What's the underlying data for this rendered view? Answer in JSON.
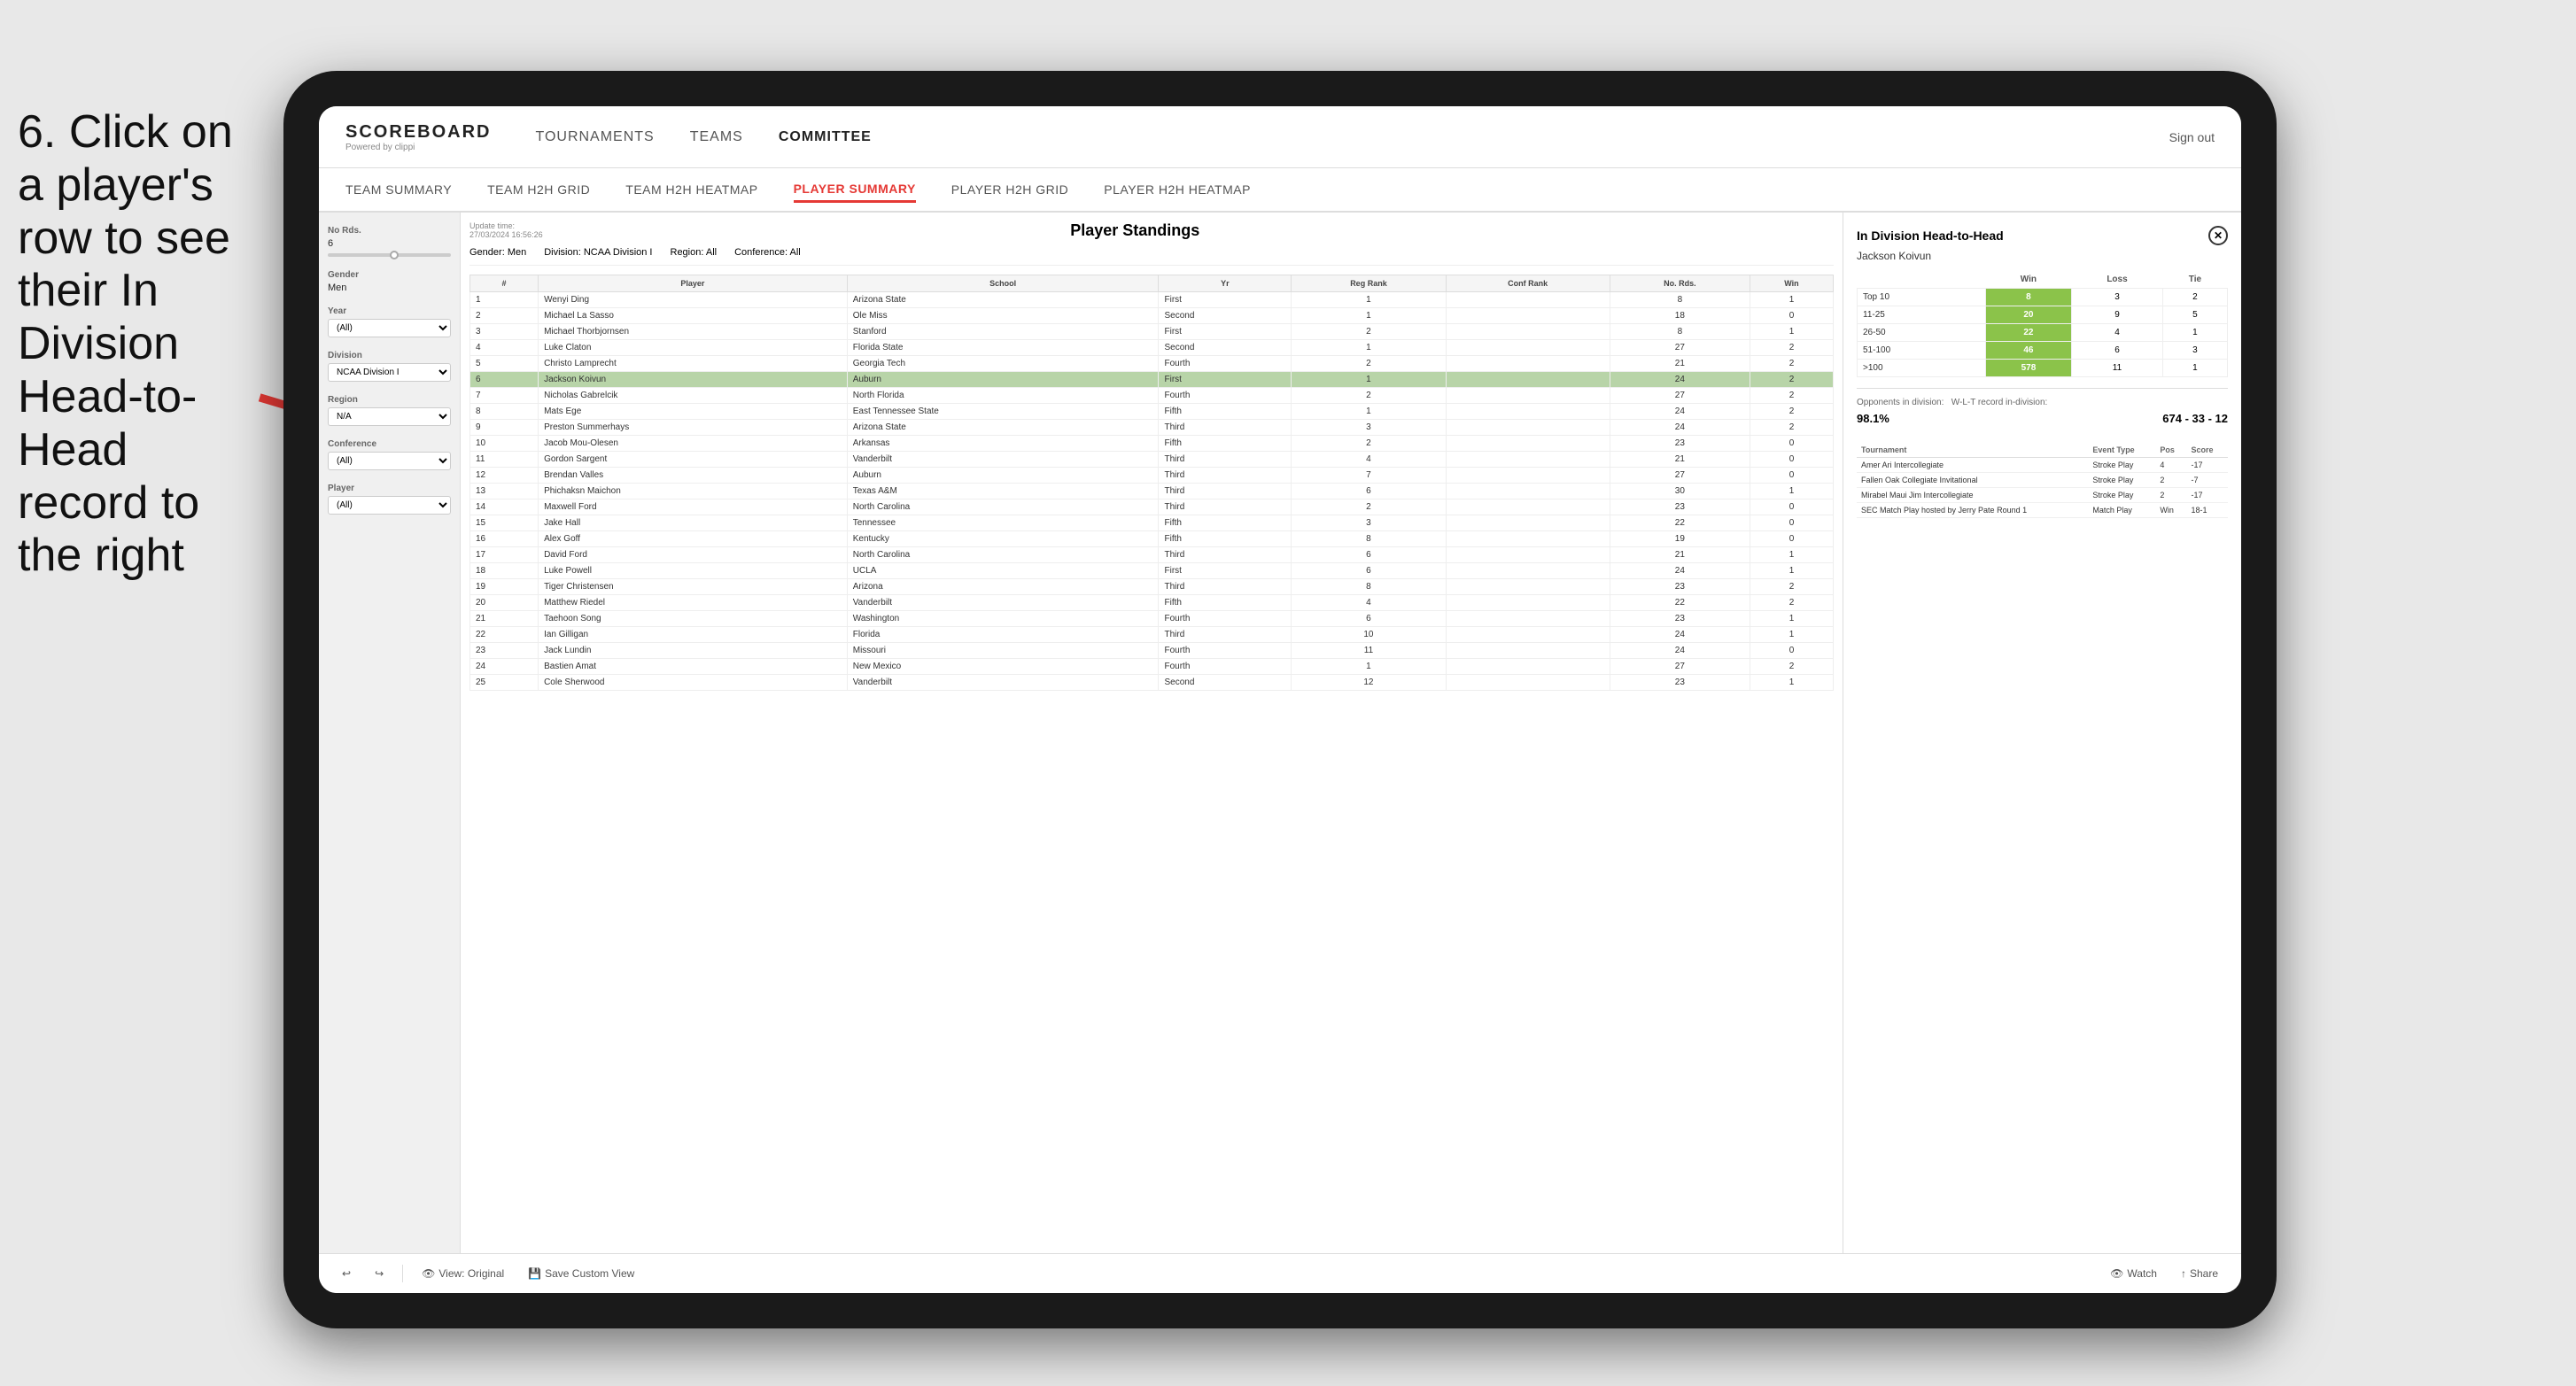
{
  "instruction": {
    "text": "6. Click on a player's row to see their In Division Head-to-Head record to the right"
  },
  "tablet": {
    "top_nav": {
      "logo": "SCOREBOARD",
      "logo_sub": "Powered by clippi",
      "nav_items": [
        "TOURNAMENTS",
        "TEAMS",
        "COMMITTEE"
      ],
      "sign_out": "Sign out"
    },
    "sub_nav": {
      "items": [
        "TEAM SUMMARY",
        "TEAM H2H GRID",
        "TEAM H2H HEATMAP",
        "PLAYER SUMMARY",
        "PLAYER H2H GRID",
        "PLAYER H2H HEATMAP"
      ],
      "active": "PLAYER SUMMARY"
    },
    "sidebar": {
      "no_rds_label": "No Rds.",
      "no_rds_value": "6",
      "gender_label": "Gender",
      "gender_value": "Men",
      "year_label": "Year",
      "year_value": "(All)",
      "division_label": "Division",
      "division_value": "NCAA Division I",
      "region_label": "Region",
      "region_value": "N/A",
      "conference_label": "Conference",
      "conference_value": "(All)",
      "player_label": "Player",
      "player_value": "(All)"
    },
    "standings": {
      "title": "Player Standings",
      "update_time": "Update time:",
      "update_date": "27/03/2024 16:56:26",
      "gender_label": "Gender:",
      "gender_value": "Men",
      "division_label": "Division:",
      "division_value": "NCAA Division I",
      "region_label": "Region:",
      "region_value": "All",
      "conference_label": "Conference:",
      "conference_value": "All",
      "columns": [
        "#",
        "Player",
        "School",
        "Yr",
        "Reg Rank",
        "Conf Rank",
        "No. Rds.",
        "Win"
      ],
      "rows": [
        {
          "num": 1,
          "player": "Wenyi Ding",
          "school": "Arizona State",
          "yr": "First",
          "reg": 1,
          "conf": "",
          "rds": 8,
          "win": 1,
          "highlighted": false
        },
        {
          "num": 2,
          "player": "Michael La Sasso",
          "school": "Ole Miss",
          "yr": "Second",
          "reg": 1,
          "conf": "",
          "rds": 18,
          "win": 0,
          "highlighted": false
        },
        {
          "num": 3,
          "player": "Michael Thorbjornsen",
          "school": "Stanford",
          "yr": "First",
          "reg": 2,
          "conf": "",
          "rds": 8,
          "win": 1,
          "highlighted": false
        },
        {
          "num": 4,
          "player": "Luke Claton",
          "school": "Florida State",
          "yr": "Second",
          "reg": 1,
          "conf": "",
          "rds": 27,
          "win": 2,
          "highlighted": false
        },
        {
          "num": 5,
          "player": "Christo Lamprecht",
          "school": "Georgia Tech",
          "yr": "Fourth",
          "reg": 2,
          "conf": "",
          "rds": 21,
          "win": 2,
          "highlighted": false
        },
        {
          "num": 6,
          "player": "Jackson Koivun",
          "school": "Auburn",
          "yr": "First",
          "reg": 1,
          "conf": "",
          "rds": 24,
          "win": 2,
          "highlighted": true
        },
        {
          "num": 7,
          "player": "Nicholas Gabrelcik",
          "school": "North Florida",
          "yr": "Fourth",
          "reg": 2,
          "conf": "",
          "rds": 27,
          "win": 2,
          "highlighted": false
        },
        {
          "num": 8,
          "player": "Mats Ege",
          "school": "East Tennessee State",
          "yr": "Fifth",
          "reg": 1,
          "conf": "",
          "rds": 24,
          "win": 2,
          "highlighted": false
        },
        {
          "num": 9,
          "player": "Preston Summerhays",
          "school": "Arizona State",
          "yr": "Third",
          "reg": 3,
          "conf": "",
          "rds": 24,
          "win": 2,
          "highlighted": false
        },
        {
          "num": 10,
          "player": "Jacob Mou-Olesen",
          "school": "Arkansas",
          "yr": "Fifth",
          "reg": 2,
          "conf": "",
          "rds": 23,
          "win": 0,
          "highlighted": false
        },
        {
          "num": 11,
          "player": "Gordon Sargent",
          "school": "Vanderbilt",
          "yr": "Third",
          "reg": 4,
          "conf": "",
          "rds": 21,
          "win": 0,
          "highlighted": false
        },
        {
          "num": 12,
          "player": "Brendan Valles",
          "school": "Auburn",
          "yr": "Third",
          "reg": 7,
          "conf": "",
          "rds": 27,
          "win": 0,
          "highlighted": false
        },
        {
          "num": 13,
          "player": "Phichaksn Maichon",
          "school": "Texas A&M",
          "yr": "Third",
          "reg": 6,
          "conf": "",
          "rds": 30,
          "win": 1,
          "highlighted": false
        },
        {
          "num": 14,
          "player": "Maxwell Ford",
          "school": "North Carolina",
          "yr": "Third",
          "reg": 2,
          "conf": "",
          "rds": 23,
          "win": 0,
          "highlighted": false
        },
        {
          "num": 15,
          "player": "Jake Hall",
          "school": "Tennessee",
          "yr": "Fifth",
          "reg": 3,
          "conf": "",
          "rds": 22,
          "win": 0,
          "highlighted": false
        },
        {
          "num": 16,
          "player": "Alex Goff",
          "school": "Kentucky",
          "yr": "Fifth",
          "reg": 8,
          "conf": "",
          "rds": 19,
          "win": 0,
          "highlighted": false
        },
        {
          "num": 17,
          "player": "David Ford",
          "school": "North Carolina",
          "yr": "Third",
          "reg": 6,
          "conf": "",
          "rds": 21,
          "win": 1,
          "highlighted": false
        },
        {
          "num": 18,
          "player": "Luke Powell",
          "school": "UCLA",
          "yr": "First",
          "reg": 6,
          "conf": "",
          "rds": 24,
          "win": 1,
          "highlighted": false
        },
        {
          "num": 19,
          "player": "Tiger Christensen",
          "school": "Arizona",
          "yr": "Third",
          "reg": 8,
          "conf": "",
          "rds": 23,
          "win": 2,
          "highlighted": false
        },
        {
          "num": 20,
          "player": "Matthew Riedel",
          "school": "Vanderbilt",
          "yr": "Fifth",
          "reg": 4,
          "conf": "",
          "rds": 22,
          "win": 2,
          "highlighted": false
        },
        {
          "num": 21,
          "player": "Taehoon Song",
          "school": "Washington",
          "yr": "Fourth",
          "reg": 6,
          "conf": "",
          "rds": 23,
          "win": 1,
          "highlighted": false
        },
        {
          "num": 22,
          "player": "Ian Gilligan",
          "school": "Florida",
          "yr": "Third",
          "reg": 10,
          "conf": "",
          "rds": 24,
          "win": 1,
          "highlighted": false
        },
        {
          "num": 23,
          "player": "Jack Lundin",
          "school": "Missouri",
          "yr": "Fourth",
          "reg": 11,
          "conf": "",
          "rds": 24,
          "win": 0,
          "highlighted": false
        },
        {
          "num": 24,
          "player": "Bastien Amat",
          "school": "New Mexico",
          "yr": "Fourth",
          "reg": 1,
          "conf": "",
          "rds": 27,
          "win": 2,
          "highlighted": false
        },
        {
          "num": 25,
          "player": "Cole Sherwood",
          "school": "Vanderbilt",
          "yr": "Second",
          "reg": 12,
          "conf": "",
          "rds": 23,
          "win": 1,
          "highlighted": false
        }
      ]
    },
    "h2h": {
      "title": "In Division Head-to-Head",
      "player_name": "Jackson Koivun",
      "table_headers": [
        "Win",
        "Loss",
        "Tie"
      ],
      "rank_rows": [
        {
          "label": "Top 10",
          "win": 8,
          "loss": 3,
          "tie": 2
        },
        {
          "label": "11-25",
          "win": 20,
          "loss": 9,
          "tie": 5
        },
        {
          "label": "26-50",
          "win": 22,
          "loss": 4,
          "tie": 1
        },
        {
          "label": "51-100",
          "win": 46,
          "loss": 6,
          "tie": 3
        },
        {
          "label": ">100",
          "win": 578,
          "loss": 11,
          "tie": 1
        }
      ],
      "opponents_label": "Opponents in division:",
      "wlt_label": "W-L-T record in-division:",
      "pct": "98.1%",
      "wlt": "674 - 33 - 12",
      "tournaments_headers": [
        "Tournament",
        "Event Type",
        "Pos",
        "Score"
      ],
      "tournaments": [
        {
          "tournament": "Amer Ari Intercollegiate",
          "type": "Stroke Play",
          "pos": 4,
          "score": "-17"
        },
        {
          "tournament": "Fallen Oak Collegiate Invitational",
          "type": "Stroke Play",
          "pos": 2,
          "score": "-7"
        },
        {
          "tournament": "Mirabel Maui Jim Intercollegiate",
          "type": "Stroke Play",
          "pos": 2,
          "score": "-17"
        },
        {
          "tournament": "SEC Match Play hosted by Jerry Pate Round 1",
          "type": "Match Play",
          "pos": "Win",
          "score": "18-1"
        }
      ]
    },
    "toolbar": {
      "view_original": "View: Original",
      "save_custom": "Save Custom View",
      "watch": "Watch",
      "share": "Share"
    }
  }
}
